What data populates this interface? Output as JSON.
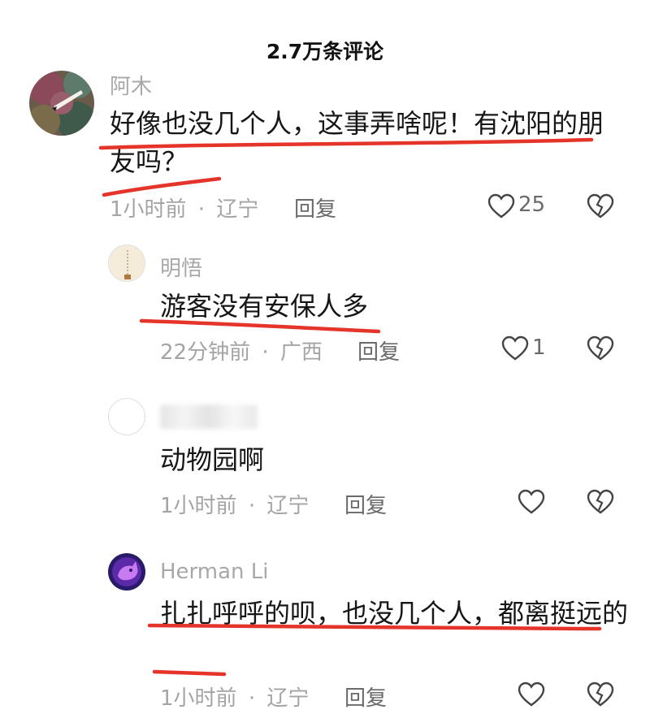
{
  "header": {
    "title": "2.7万条评论"
  },
  "comments": [
    {
      "name": "阿木",
      "text": "好像也没几个人，这事弄啥呢！有沈阳的朋友吗？",
      "time": "1小时前",
      "location": "辽宁",
      "reply_label": "回复",
      "likes": "25"
    },
    {
      "name": "明悟",
      "text": "游客没有安保人多",
      "time": "22分钟前",
      "location": "广西",
      "reply_label": "回复",
      "likes": "1"
    },
    {
      "name": "",
      "text": "动物园啊",
      "time": "1小时前",
      "location": "辽宁",
      "reply_label": "回复",
      "likes": ""
    },
    {
      "name": "Herman Li",
      "text": "扎扎呼呼的呗，也没几个人，都离挺远的",
      "time": "1小时前",
      "location": "辽宁",
      "reply_label": "回复",
      "likes": ""
    }
  ],
  "meta_separator": "·",
  "colors": {
    "underline": "#e5352b",
    "text": "#161616",
    "muted": "#a4a4a4"
  },
  "icons": {
    "like": "heart-outline-icon",
    "dislike": "broken-heart-icon"
  }
}
